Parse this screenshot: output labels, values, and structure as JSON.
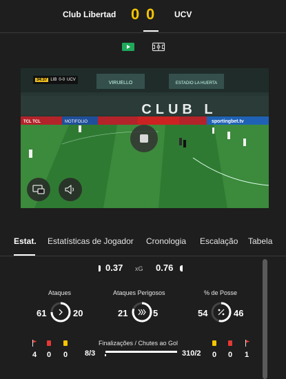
{
  "match": {
    "home_team": "Club Libertad",
    "away_team": "UCV",
    "home_score": "0",
    "away_score": "0"
  },
  "view_toggle": {
    "video_icon": "play-video-icon",
    "pitch_icon": "pitch-icon"
  },
  "video": {
    "scoreboard_clock": "34:37",
    "scoreboard_home": "LIB",
    "scoreboard_score": "0-0",
    "scoreboard_away": "UCV",
    "stadium_sign": "CLUB L",
    "board_home": "TCL TCL",
    "board_mid": "MOTIFOLIO",
    "board_right": "sportingbet.tv",
    "sign_top_left": "VIRUELLO",
    "sign_top_right": "ESTADIO LA HUERTA",
    "stop_icon": "stop-icon",
    "pip_icon": "picture-in-picture-icon",
    "volume_icon": "volume-icon",
    "colors": {
      "pitch": "#2f7a32",
      "pitch_light": "#3c8a3c",
      "stands": "#2d3f3a"
    }
  },
  "tabs": [
    {
      "label": "Estat.",
      "active": true
    },
    {
      "label": "Estatísticas de Jogador",
      "active": false
    },
    {
      "label": "Cronologia",
      "active": false
    },
    {
      "label": "Escalação",
      "active": false
    },
    {
      "label": "Tabela",
      "active": false
    }
  ],
  "xg": {
    "home": "0.37",
    "label": "xG",
    "away": "0.76"
  },
  "stats": [
    {
      "label": "Ataques",
      "home": "61",
      "away": "20",
      "home_fraction": 0.75,
      "icon": "chevron-right-icon"
    },
    {
      "label": "Ataques Perigosos",
      "home": "21",
      "away": "5",
      "home_fraction": 0.81,
      "icon": "triple-chevron-icon"
    },
    {
      "label": "% de Posse",
      "home": "54",
      "away": "46",
      "home_fraction": 0.54,
      "icon": "percent-icon"
    }
  ],
  "finishes": {
    "label": "Finalizações / Chutes ao Gol",
    "home": "8/3",
    "away": "310/2",
    "home_fraction": 0.02
  },
  "cards": {
    "home": {
      "corners": "4",
      "red": "0",
      "yellow": "0"
    },
    "away": {
      "yellow": "0",
      "red": "0",
      "corners": "1"
    },
    "colors": {
      "red": "#e53935",
      "yellow": "#f5c400"
    }
  }
}
